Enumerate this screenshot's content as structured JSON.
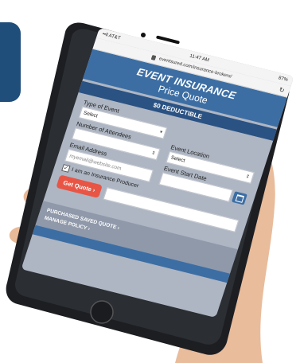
{
  "status": {
    "carrier": "••ll AT&T",
    "time": "11:47 AM",
    "battery": "87%"
  },
  "browser": {
    "url": "eventsured.com/insurance-brokers/"
  },
  "banner": {
    "title": "EVENT INSURANCE",
    "subtitle": "Price Quote",
    "deductible": "$0 DEDUCTIBLE"
  },
  "form": {
    "type_label": "Type of Event",
    "type_value": "Select",
    "location_label": "Event Location",
    "location_value": "Select",
    "attendees_label": "Number of Attendees",
    "date_label": "Event Start Date",
    "email_label": "Email Address",
    "email_placeholder": "myemail@website.com",
    "producer_label": "I am an Insurance Producer",
    "quote_button": "Get Quote ›"
  },
  "links": {
    "purchased": "PURCHASED SAVED QUOTE ›",
    "manage": "MANAGE POLICY ›"
  },
  "colors": {
    "brand_blue": "#3c6ea4",
    "dark_blue": "#2a5283",
    "button_red": "#e85545",
    "corner_blue": "#1f4e7a"
  }
}
